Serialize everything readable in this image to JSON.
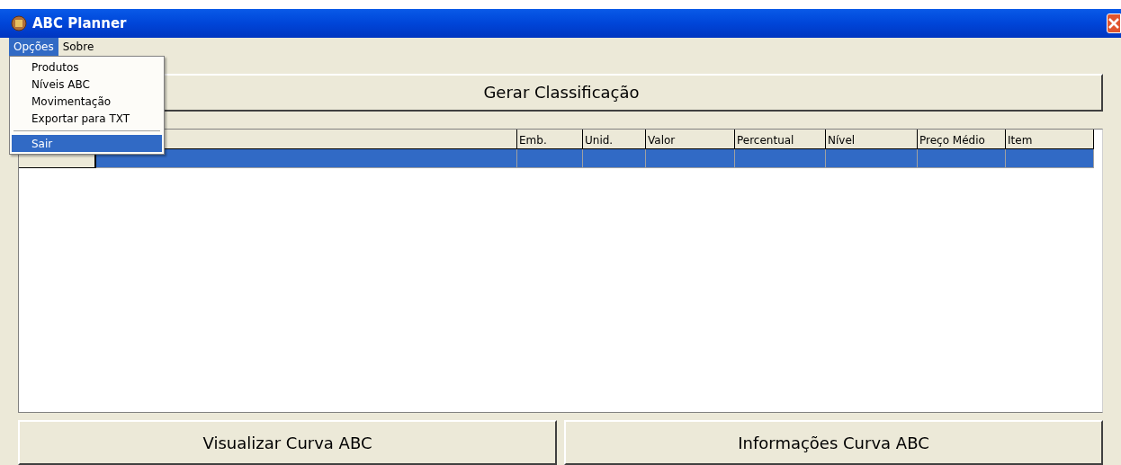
{
  "window": {
    "title": "ABC Planner"
  },
  "menu_bar": [
    {
      "label": "Opções",
      "selected": true
    },
    {
      "label": "Sobre",
      "selected": false
    }
  ],
  "dropdown": [
    {
      "kind": "item",
      "label": "Produtos",
      "selected": false
    },
    {
      "kind": "item",
      "label": "Níveis ABC",
      "selected": false
    },
    {
      "kind": "item",
      "label": "Movimentação",
      "selected": false
    },
    {
      "kind": "item",
      "label": "Exportar para TXT",
      "selected": false
    },
    {
      "kind": "separator"
    },
    {
      "kind": "item",
      "label": "Sair",
      "selected": true
    }
  ],
  "generate_button": "Gerar Classificação",
  "table": {
    "columns": [
      "Emb.",
      "Unid.",
      "Valor",
      "Percentual",
      "Nível",
      "Preço Médio",
      "Item"
    ],
    "rows": [
      {
        "selected": true
      }
    ]
  },
  "buttons": [
    "Visualizar Curva ABC",
    "Informações Curva ABC"
  ]
}
